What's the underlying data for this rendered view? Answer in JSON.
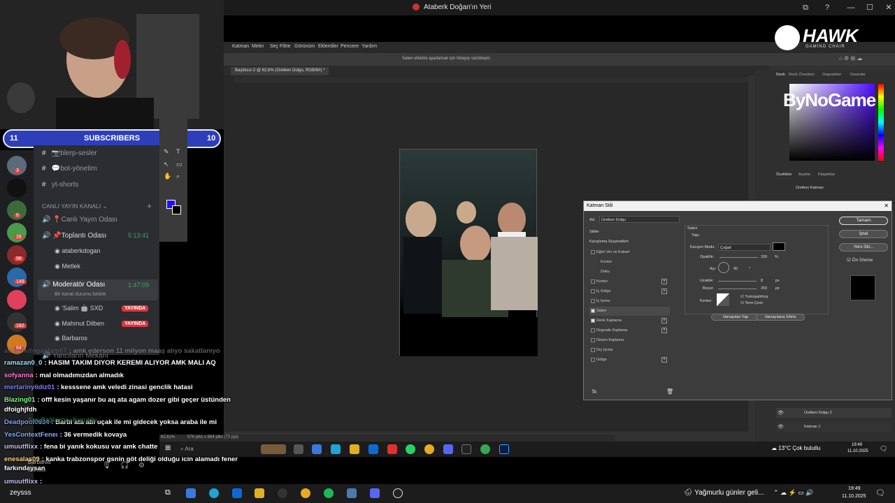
{
  "window": {
    "title": "Ataberk Doğan'ın Yeri"
  },
  "webcam": {
    "label": "streamer-webcam"
  },
  "subscribers": {
    "left_count": "11",
    "label": "SUBSCRIBERS",
    "right_count": "10"
  },
  "discord": {
    "rail_badges": [
      "3",
      "6",
      "26",
      "98",
      "149",
      "182",
      "64"
    ],
    "channels": [
      {
        "prefix": "#",
        "label": "📷blerp-sesler"
      },
      {
        "prefix": "#",
        "label": "💬bot-yönetim"
      },
      {
        "prefix": "#",
        "label": "yt-shorts"
      }
    ],
    "category": "CANLI YAYIN KANALI",
    "voice_channels": {
      "live": "📍Canlı Yayın Odası",
      "meeting": "📌Toplantı Odası",
      "meeting_time": "5:13:41",
      "moderator": "Moderatör Odası",
      "moderator_time": "1:47:09",
      "moderator_status": "Bir kanal durumu belirle",
      "announcements_partial": "Yancıların Mekanı"
    },
    "meeting_users": [
      "ataberkdogan",
      "Metlek"
    ],
    "mod_users": [
      {
        "name": "'Salim 🤖 SXD",
        "badge": "YAYINDA"
      },
      {
        "name": "Mahmut Dilben",
        "badge": "YAYINDA"
      },
      {
        "name": "Barbaros",
        "badge": ""
      }
    ],
    "connection_status": "Ses Bağlantısı Kuruldu",
    "user_panel_name": "Barbaros",
    "user_panel_status": "aranada"
  },
  "chat": [
    {
      "user": "ataberkdoganfam07",
      "text": ": amk ederson 11 milyon maaş alıyo sakatlanıyo",
      "color": "#8899aa"
    },
    {
      "user": "ramazan0_0",
      "text": ": HASIM TAKIM DIYOR KEREMI ALIYOR AMK MALI AQ",
      "color": "#a3e0ff"
    },
    {
      "user": "sofyanna",
      "text": ": mal olmadımızdan almadık",
      "color": "#ff7fd0"
    },
    {
      "user": "mertarinyildiz01",
      "text": ": kesssene amk veledi zinasi genclik hatasi",
      "color": "#7f7fff"
    },
    {
      "user": "Blazing01",
      "text": ": offf kesin yaşanır bu aq ata agam dozer gibi geçer üstünden",
      "color": "#7fff7f"
    },
    {
      "user": "",
      "text": "dfoighjfdh",
      "color": "#ffffff"
    },
    {
      "user": "Deadpool0634",
      "text": ": Barbi ata abi uçak ile mi gidecek yoksa araba ile mi",
      "color": "#7f9fff"
    },
    {
      "user": "YesContextFeneı",
      "text": ": 36 vermedik kovaya",
      "color": "#7fb0ff"
    },
    {
      "user": "umuutflixx",
      "text": ": fena bi yanık kokusu var amk chatte",
      "color": "#c0c0ff"
    },
    {
      "user": "enesalas09",
      "text": ": kanka trabzonspor gsnin göt deliği olduğu icin alamadı fener",
      "color": "#ffd27f"
    },
    {
      "user": "",
      "text": "farkındaysan",
      "color": "#ffffff"
    },
    {
      "user": "umuutflixx",
      "text": ":",
      "color": "#c0c0ff"
    },
    {
      "user": "zeysss",
      "text": "",
      "color": "#ffffff"
    }
  ],
  "photoshop": {
    "menu": [
      "Katman",
      "Metin",
      "Seç",
      "Filtre",
      "Görünüm",
      "Eklentiler",
      "Pencere",
      "Yardım"
    ],
    "options_hint": "Saten efektini ayarlamak için tıklayıp sürükleyin.",
    "doc_tab": "Başlıksız-2 @ 62,6% (Üretken Dolgu, RGB/8#) *",
    "status": "62,61%",
    "status_size": "576 piks x 864 piks (72 ppi)",
    "right_tabs": [
      "Renk",
      "Renk Örnekleri",
      "Degradeler",
      "Desenler"
    ],
    "props_tabs": [
      "Özellikler",
      "Ayarlar",
      "Kitaplıklar"
    ],
    "props_item": "Üretken Katman",
    "layers": [
      "Üretken Dolgu 2",
      "Katman 1"
    ],
    "sponsor_logo": "ByNoGame"
  },
  "dialog": {
    "title": "Katman Stili",
    "name_label": "Ad:",
    "name_value": "Üretken Dolgu",
    "styles_header": "Stiller",
    "blend_options": "Karıştırma Seçenekleri",
    "style_items": [
      {
        "label": "Eğim Ver ve Kabart",
        "checked": false,
        "plus": false,
        "indent": false
      },
      {
        "label": "Kontur",
        "checked": false,
        "plus": false,
        "indent": true
      },
      {
        "label": "Doku",
        "checked": false,
        "plus": false,
        "indent": true
      },
      {
        "label": "Kontur",
        "checked": false,
        "plus": true,
        "indent": false
      },
      {
        "label": "İç Gölge",
        "checked": false,
        "plus": true,
        "indent": false
      },
      {
        "label": "İç Işıma",
        "checked": false,
        "plus": false,
        "indent": false
      },
      {
        "label": "Saten",
        "checked": true,
        "plus": false,
        "indent": false
      },
      {
        "label": "Renk Kaplama",
        "checked": true,
        "plus": true,
        "indent": false
      },
      {
        "label": "Degrade Kaplama",
        "checked": false,
        "plus": true,
        "indent": false
      },
      {
        "label": "Desen Kaplama",
        "checked": false,
        "plus": false,
        "indent": false
      },
      {
        "label": "Dış Işıma",
        "checked": false,
        "plus": false,
        "indent": false
      },
      {
        "label": "Gölge",
        "checked": false,
        "plus": true,
        "indent": false
      }
    ],
    "satin": {
      "section": "Saten",
      "structure": "Yapı",
      "blend_mode_label": "Karışım Modu:",
      "blend_mode_value": "Çoğalt",
      "opacity_label": "Opaklık:",
      "opacity_value": "100",
      "opacity_unit": "%",
      "angle_label": "Açı:",
      "angle_value": "90",
      "angle_unit": "°",
      "distance_label": "Uzaklık:",
      "distance_value": "8",
      "distance_unit": "px",
      "size_label": "Boyut:",
      "size_value": "250",
      "size_unit": "px",
      "contour_label": "Kontur:",
      "antialias": "Yumuşatılmış",
      "invert": "Tersi Çevir",
      "make_default": "Varsayılan Yap",
      "reset_default": "Varsayılana Sıfırla"
    },
    "buttons": {
      "ok": "Tamam",
      "cancel": "İptal",
      "new_style": "Yeni Stil...",
      "preview": "Ön İzleme"
    }
  },
  "ps_taskbar": {
    "search": "Ara",
    "weather": "13°C  Çok bulutlu",
    "time": "19:49",
    "date": "11.10.2025"
  },
  "taskbar": {
    "weather": "Yağmurlu günler geli...",
    "time": "19:49",
    "date": "11.10.2025"
  },
  "hawk": {
    "brand": "HAWK",
    "sub": "GAMING CHAIR"
  },
  "colors": {
    "accent_blue": "#2d3fb8",
    "live_red": "#da373c",
    "ps_bg": "#323232"
  }
}
